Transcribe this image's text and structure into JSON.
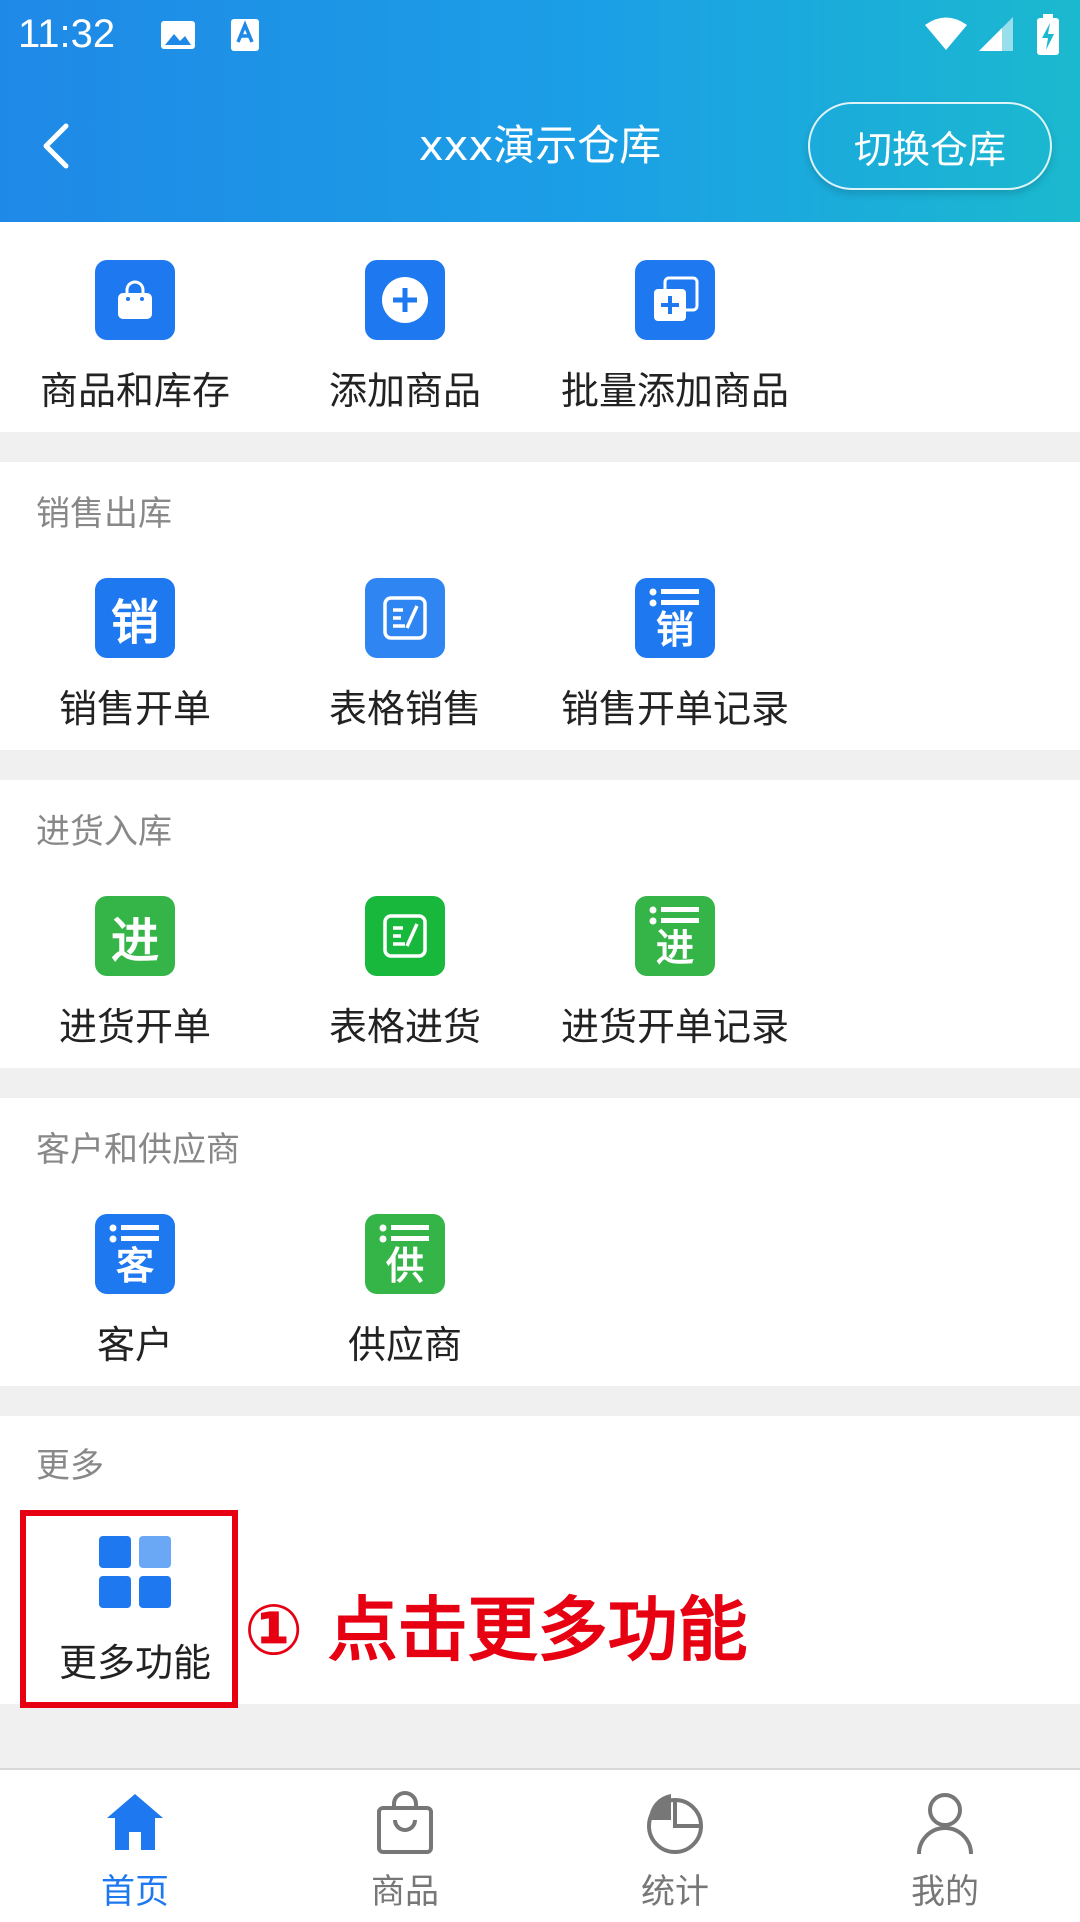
{
  "status_bar": {
    "time": "11:32"
  },
  "header": {
    "title": "xxx演示仓库",
    "switch_label": "切换仓库"
  },
  "top_items": [
    {
      "label": "商品和库存",
      "icon": "shopping-bag-icon"
    },
    {
      "label": "添加商品",
      "icon": "plus-circle-icon"
    },
    {
      "label": "批量添加商品",
      "icon": "batch-add-icon"
    }
  ],
  "sections": {
    "sales": {
      "title": "销售出库",
      "items": [
        {
          "label": "销售开单",
          "glyph": "销"
        },
        {
          "label": "表格销售",
          "icon": "form-edit-icon"
        },
        {
          "label": "销售开单记录",
          "glyph": "销"
        }
      ]
    },
    "purchase": {
      "title": "进货入库",
      "items": [
        {
          "label": "进货开单",
          "glyph": "进"
        },
        {
          "label": "表格进货",
          "icon": "form-edit-icon"
        },
        {
          "label": "进货开单记录",
          "glyph": "进"
        }
      ]
    },
    "partners": {
      "title": "客户和供应商",
      "items": [
        {
          "label": "客户",
          "glyph": "客"
        },
        {
          "label": "供应商",
          "glyph": "供"
        }
      ]
    },
    "more": {
      "title": "更多",
      "items": [
        {
          "label": "更多功能",
          "icon": "grid-apps-icon"
        }
      ]
    }
  },
  "annotation": {
    "text": "① 点击更多功能"
  },
  "bottom_nav": [
    {
      "label": "首页",
      "icon": "home-icon",
      "active": true
    },
    {
      "label": "商品",
      "icon": "bag-icon",
      "active": false
    },
    {
      "label": "统计",
      "icon": "pie-chart-icon",
      "active": false
    },
    {
      "label": "我的",
      "icon": "user-icon",
      "active": false
    }
  ],
  "colors": {
    "accent": "#1e78f0",
    "green": "#35b548",
    "annotation_red": "#e60012"
  }
}
